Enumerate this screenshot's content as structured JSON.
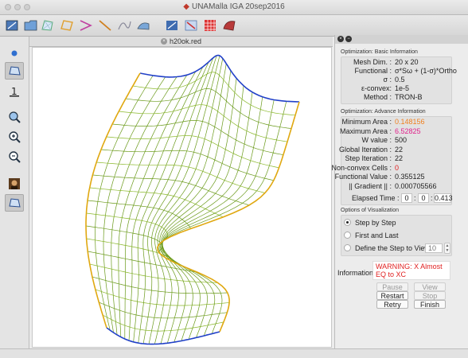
{
  "window": {
    "title": "UNAMalla IGA 20sep2016"
  },
  "tab": {
    "label": "h20ok.red"
  },
  "basic": {
    "title": "Optimization: Basic Information",
    "rows": [
      {
        "label": "Mesh Dim. :",
        "value": "20 x 20"
      },
      {
        "label": "Functional :",
        "value": "σ*Sω + (1-σ)*Ortho"
      },
      {
        "label": "σ :",
        "value": "0.5"
      },
      {
        "label": "ε-convex:",
        "value": "1e-5"
      },
      {
        "label": "Method :",
        "value": "TRON-B"
      }
    ]
  },
  "advance": {
    "title": "Optimization: Advance Information",
    "rows": [
      {
        "label": "Minimum Area :",
        "value": "0.148156",
        "color": "#f08020"
      },
      {
        "label": "Maximum Area :",
        "value": "6.52825",
        "color": "#e0208a"
      },
      {
        "label": "W value :",
        "value": "500",
        "color": "#222222"
      },
      {
        "label": "Global Iteration :",
        "value": "22",
        "color": "#222222"
      },
      {
        "label": "Step Iteration :",
        "value": "22",
        "color": "#222222"
      },
      {
        "label": "Non-convex Cells :",
        "value": "0",
        "color": "#e02020"
      },
      {
        "label": "Functional Value :",
        "value": "0.355125",
        "color": "#222222"
      },
      {
        "label": "|| Gradient || :",
        "value": "0.000705566",
        "color": "#222222"
      }
    ],
    "elapsed_label": "Elapsed Time :",
    "elapsed": {
      "h": "0",
      "m": "0",
      "s": "0.413"
    }
  },
  "visual": {
    "title": "Options of Visualization",
    "options": [
      {
        "label": "Step by Step",
        "selected": true
      },
      {
        "label": "First and Last",
        "selected": false
      },
      {
        "label": "Define the Step to View:",
        "selected": false
      }
    ],
    "step_value": "10"
  },
  "information": {
    "label": "Information:",
    "message": "WARNING: X Almost EQ to XC"
  },
  "buttons": {
    "pause": "Pause",
    "view_step": "View Step",
    "restart": "Restart",
    "stop": "Stop",
    "retry": "Retry",
    "finish": "Finish"
  },
  "mesh": {
    "dimension": 20,
    "grid_color": "#6a9a1a",
    "boundary_blue": "#2040c8",
    "boundary_yellow": "#e0a810"
  }
}
